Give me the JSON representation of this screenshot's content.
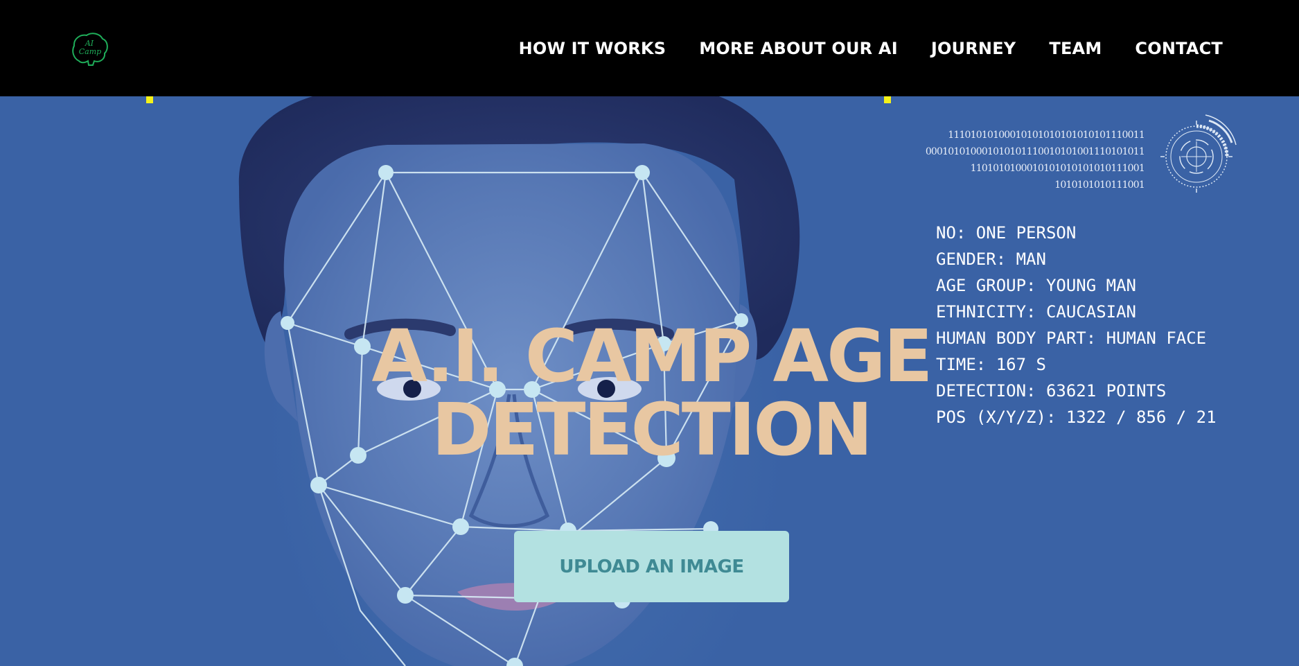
{
  "header": {
    "logo_text": "AI Camp",
    "nav": [
      {
        "label": "HOW IT WORKS"
      },
      {
        "label": "MORE ABOUT OUR AI"
      },
      {
        "label": "JOURNEY"
      },
      {
        "label": "TEAM"
      },
      {
        "label": "CONTACT"
      }
    ]
  },
  "hero": {
    "title_line1": "A.I. CAMP AGE",
    "title_line2": "DETECTION",
    "upload_label": "UPLOAD AN IMAGE",
    "binary_lines": [
      "11101010100010101010101010101110011",
      "000101010001010101110010101001110101011",
      "1101010100010101010101010111001",
      "1010101010111001"
    ],
    "readout": [
      "NO: ONE PERSON",
      "GENDER: MAN",
      "AGE GROUP: YOUNG MAN",
      "ETHNICITY: CAUCASIAN",
      "HUMAN BODY PART: HUMAN FACE",
      "TIME: 167 S",
      "DETECTION: 63621 POINTS",
      "POS (X/Y/Z): 1322 / 856 / 21"
    ]
  },
  "colors": {
    "navbar_bg": "#000000",
    "hero_bg": "#3c64a6",
    "title": "#e8c7a2",
    "button_bg": "#b3e1e1",
    "button_text": "#3f8a94",
    "logo_green": "#1fae5a",
    "accent_yellow": "#f4f21a"
  }
}
